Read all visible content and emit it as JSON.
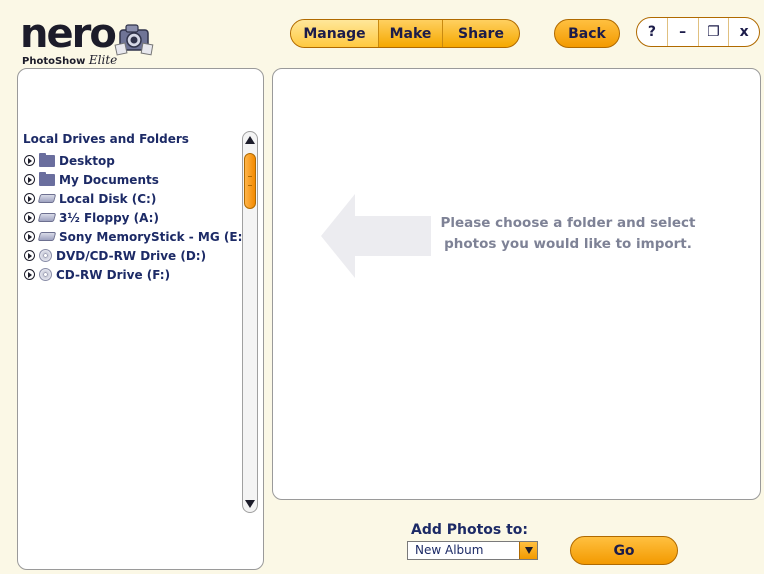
{
  "logo": {
    "brand": "nero",
    "product": "PhotoShow",
    "edition": "Elite"
  },
  "tabs": [
    {
      "label": "Manage",
      "selected": true
    },
    {
      "label": "Make"
    },
    {
      "label": "Share"
    }
  ],
  "back_label": "Back",
  "window_controls": {
    "help": "?",
    "minimize": "–",
    "restore": "❐",
    "close": "x"
  },
  "left_panel": {
    "title": "Local Drives and Folders",
    "items": [
      {
        "label": "Desktop",
        "icon": "folder-icon"
      },
      {
        "label": "My Documents",
        "icon": "folder-icon"
      },
      {
        "label": "Local Disk (C:)",
        "icon": "hard-disk-icon"
      },
      {
        "label": "3½ Floppy (A:)",
        "icon": "floppy-drive-icon"
      },
      {
        "label": "Sony MemoryStick - MG (E:)",
        "icon": "memory-stick-drive-icon"
      },
      {
        "label": "DVD/CD-RW Drive (D:)",
        "icon": "cd-drive-icon"
      },
      {
        "label": "CD-RW Drive (F:)",
        "icon": "cd-drive-icon"
      }
    ]
  },
  "right_panel": {
    "hint": "Please choose a folder and select photos you would like to import."
  },
  "add_photos": {
    "label": "Add Photos to:",
    "selected": "New Album",
    "go_label": "Go"
  },
  "colors": {
    "background": "#fbf8e6",
    "accent": "#f5a800",
    "text": "#1c2a66",
    "hint_text": "#7e8296"
  }
}
